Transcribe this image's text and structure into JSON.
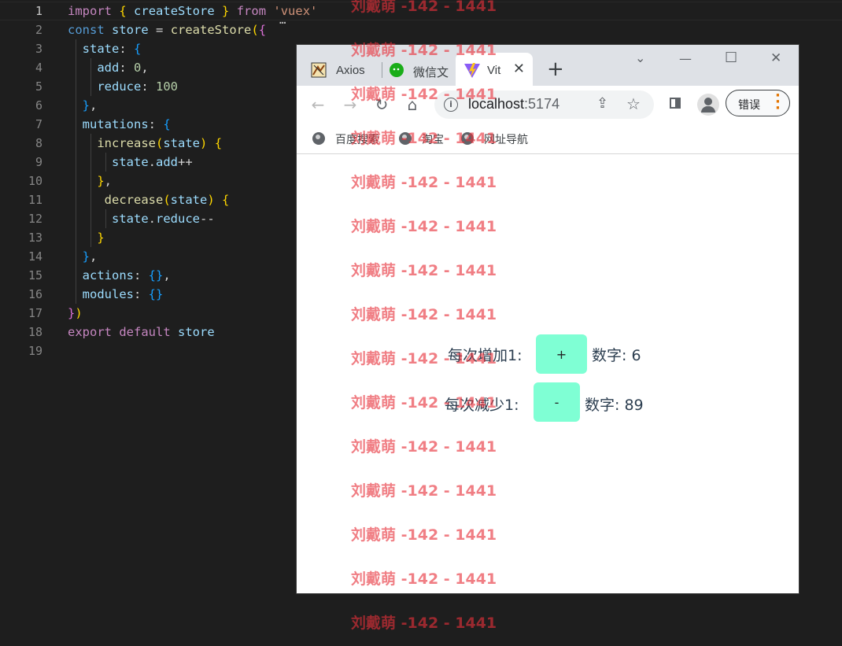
{
  "editor": {
    "line_numbers": [
      "1",
      "2",
      "3",
      "4",
      "5",
      "6",
      "7",
      "8",
      "9",
      "10",
      "11",
      "12",
      "13",
      "14",
      "15",
      "16",
      "17",
      "18",
      "19"
    ],
    "fold_marker": "…"
  },
  "browser": {
    "tabs": [
      {
        "title": "Axios",
        "icon": "axios-favicon"
      },
      {
        "title": "微信文",
        "icon": "wechat-favicon"
      },
      {
        "title": "Vit",
        "icon": "vite-favicon"
      }
    ],
    "new_tab": "+",
    "window_controls": {
      "minimize": "—",
      "maximize": "☐",
      "close": "✕",
      "tab_search": "⌄"
    },
    "url": {
      "host": "localhost",
      "port": ":5174"
    },
    "error_button": "错误",
    "bookmarks": [
      "百度搜索",
      "淘宝",
      "网址导航"
    ]
  },
  "app": {
    "increase_label": "每次增加1:",
    "increase_button": "+",
    "increase_value": "数字: 6",
    "decrease_label": "每次减少1:",
    "decrease_button": "-",
    "decrease_value": "数字: 89"
  },
  "watermark": {
    "text": "刘戴萌 -142 - 1441"
  },
  "colors": {
    "editor_bg": "#1e1e1e",
    "button_bg": "#7fffd4",
    "watermark": "#e8303a"
  }
}
